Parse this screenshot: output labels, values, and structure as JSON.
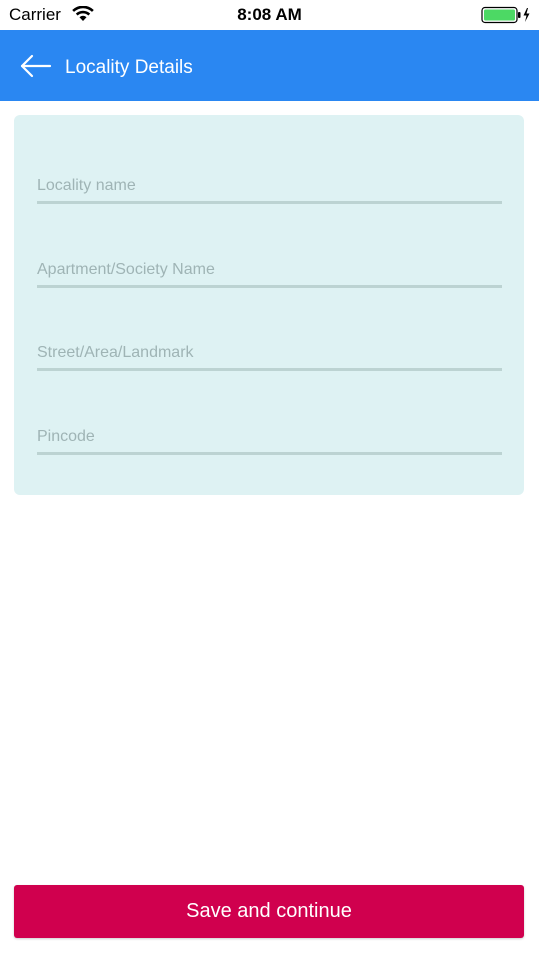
{
  "status_bar": {
    "carrier": "Carrier",
    "time": "8:08 AM",
    "wifi_icon": "wifi-icon",
    "battery_icon": "battery-charging-icon",
    "battery_color": "#4cd964"
  },
  "app_bar": {
    "title": "Locality Details",
    "back_icon": "arrow-left-icon",
    "background": "#2a87f2"
  },
  "form": {
    "background": "#def2f3",
    "fields": [
      {
        "placeholder": "Locality name",
        "value": ""
      },
      {
        "placeholder": "Apartment/Society Name",
        "value": ""
      },
      {
        "placeholder": "Street/Area/Landmark",
        "value": ""
      },
      {
        "placeholder": "Pincode",
        "value": ""
      }
    ]
  },
  "footer": {
    "save_label": "Save and continue",
    "save_color": "#d0004e"
  }
}
